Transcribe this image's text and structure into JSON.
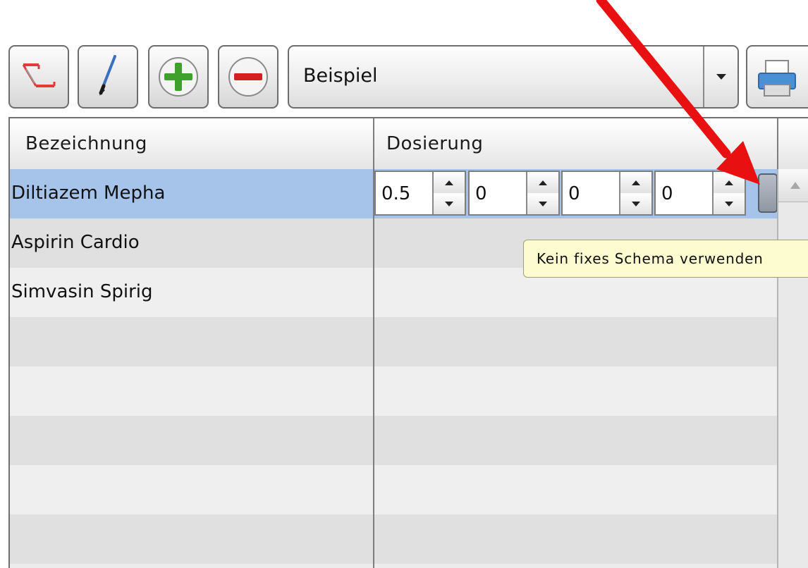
{
  "toolbar": {
    "buttons": [
      {
        "name": "delete-schema-button",
        "icon": "red-corner-pencil-icon"
      },
      {
        "name": "edit-button",
        "icon": "pen-icon"
      },
      {
        "name": "add-button",
        "icon": "green-plus-icon"
      },
      {
        "name": "remove-button",
        "icon": "red-minus-icon"
      }
    ],
    "combo_value": "Beispiel",
    "print_icon": "printer-icon"
  },
  "table": {
    "columns": [
      "Bezeichnung",
      "Dosierung"
    ],
    "rows": [
      {
        "name": "Diltiazem Mepha",
        "selected": true
      },
      {
        "name": "Aspirin Cardio",
        "selected": false
      },
      {
        "name": "Simvasin Spirig",
        "selected": false
      },
      {
        "name": "",
        "selected": false
      },
      {
        "name": "",
        "selected": false
      },
      {
        "name": "",
        "selected": false
      },
      {
        "name": "",
        "selected": false
      },
      {
        "name": "",
        "selected": false
      }
    ],
    "dose_values": [
      "0.5",
      "0",
      "0",
      "0"
    ]
  },
  "tooltip": {
    "text": "Kein fixes Schema verwenden"
  },
  "colors": {
    "selection": "#a6c3ea",
    "tooltip_bg": "#fcfcd0",
    "annotation_arrow": "#e81010"
  }
}
